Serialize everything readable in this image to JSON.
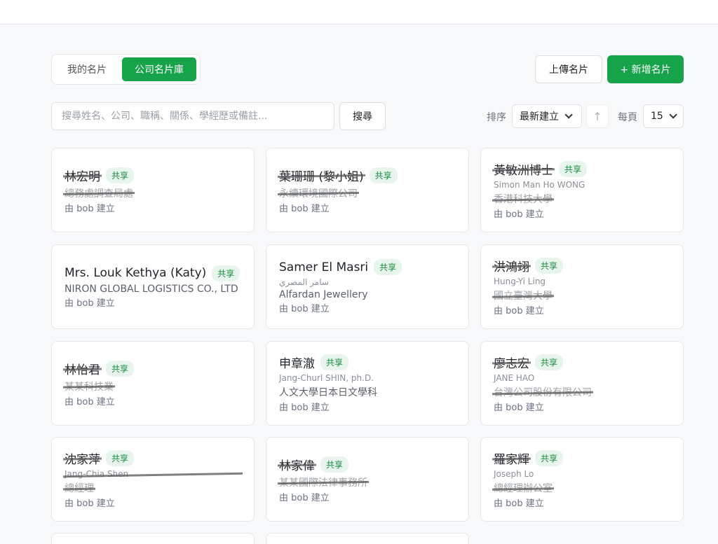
{
  "tabs": {
    "mine": "我的名片",
    "company": "公司名片庫"
  },
  "actions": {
    "upload": "上傳名片",
    "add": "+ 新增名片"
  },
  "search": {
    "placeholder": "搜尋姓名、公司、職稱、關係、學經歷或備註...",
    "button": "搜尋"
  },
  "sort": {
    "label": "排序",
    "value": "最新建立",
    "direction": "↑"
  },
  "per_page": {
    "label": "每頁",
    "value": "15"
  },
  "cards": [
    {
      "name": "林宏明",
      "name_redacted": true,
      "badge": "共享",
      "sub": "",
      "org": "總務處調查局處",
      "org_redacted": true,
      "created_by": "由 bob 建立"
    },
    {
      "name": "葉珊珊 (黎小姐)",
      "name_redacted": true,
      "badge": "共享",
      "sub": "",
      "org": "永續環境國際公司",
      "org_redacted": true,
      "created_by": "由 bob 建立"
    },
    {
      "name": "黃敏洲博士",
      "name_redacted": true,
      "badge": "共享",
      "sub": "Simon Man Ho WONG",
      "sub_redacted": false,
      "org": "香港科技大學",
      "org_redacted": true,
      "created_by": "由 bob 建立"
    },
    {
      "name": "Mrs. Louk Kethya (Katy)",
      "name_redacted": false,
      "badge": "共享",
      "sub": "",
      "org": "NIRON GLOBAL LOGISTICS CO., LTD",
      "org_redacted": false,
      "created_by": "由 bob 建立"
    },
    {
      "name": "Samer El Masri",
      "name_redacted": false,
      "badge": "共享",
      "sub": "سامر المصري",
      "org": "Alfardan Jewellery",
      "org_redacted": false,
      "created_by": "由 bob 建立"
    },
    {
      "name": "洪鴻翊",
      "name_redacted": true,
      "badge": "共享",
      "sub": "Hung-Yi Ling",
      "org": "國立臺灣大學",
      "org_redacted": true,
      "created_by": "由 bob 建立"
    },
    {
      "name": "林怡君",
      "name_redacted": true,
      "badge": "共享",
      "sub": "",
      "org": "某某科技業",
      "org_redacted": true,
      "created_by": "由 bob 建立"
    },
    {
      "name": "申章澈",
      "name_redacted": false,
      "badge": "共享",
      "sub": "Jang-Churl SHIN, ph.D.",
      "org": "人文大學日本日文學科",
      "org_redacted": false,
      "created_by": "由 bob 建立"
    },
    {
      "name": "廖志宏",
      "name_redacted": true,
      "badge": "共享",
      "sub": "JANE HAO",
      "org": "台灣公司股份有限公司",
      "org_redacted": true,
      "created_by": "由 bob 建立"
    },
    {
      "name": "沈家萍",
      "name_redacted": true,
      "badge": "共享",
      "sub": "Jang-Chia Shen",
      "sub_redacted": true,
      "org": "總經理",
      "org_redacted": true,
      "created_by": "由 bob 建立"
    },
    {
      "name": "林家偉",
      "name_redacted": true,
      "badge": "共享",
      "sub": "",
      "org": "某某國際法律事務所",
      "org_redacted": true,
      "created_by": "由 bob 建立"
    },
    {
      "name": "羅家輝",
      "name_redacted": true,
      "badge": "共享",
      "sub": "Joseph Lo",
      "org": "總經理辦公室",
      "org_redacted": true,
      "created_by": "由 bob 建立"
    }
  ],
  "colors": {
    "primary": "#17a34a",
    "badge_bg": "#e8f5ec",
    "badge_text": "#178a3f"
  }
}
